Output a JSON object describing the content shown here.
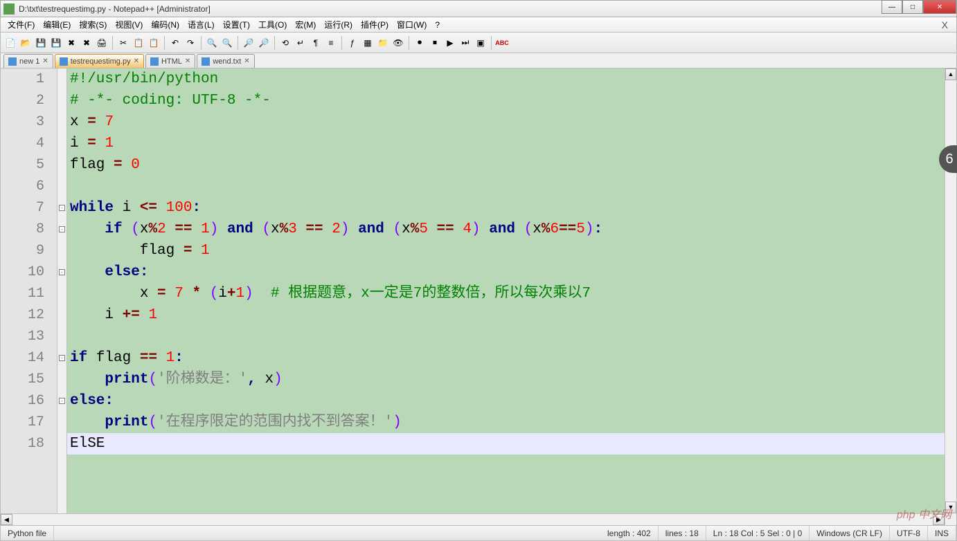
{
  "window": {
    "title": "D:\\txt\\testrequestimg.py - Notepad++ [Administrator]"
  },
  "menu": [
    "文件(F)",
    "编辑(E)",
    "搜索(S)",
    "视图(V)",
    "编码(N)",
    "语言(L)",
    "设置(T)",
    "工具(O)",
    "宏(M)",
    "运行(R)",
    "插件(P)",
    "窗口(W)",
    "?"
  ],
  "tabs": [
    {
      "label": "new 1",
      "active": false
    },
    {
      "label": "testrequestimg.py",
      "active": true
    },
    {
      "label": "HTML",
      "active": false
    },
    {
      "label": "wend.txt",
      "active": false
    }
  ],
  "code": {
    "lines": [
      {
        "n": 1,
        "tokens": [
          {
            "t": "#!/usr/bin/python",
            "c": "c-comment"
          }
        ]
      },
      {
        "n": 2,
        "tokens": [
          {
            "t": "# -*- coding: UTF-8 -*-",
            "c": "c-comment"
          }
        ]
      },
      {
        "n": 3,
        "tokens": [
          {
            "t": "x ",
            "c": "c-id"
          },
          {
            "t": "=",
            "c": "c-opred"
          },
          {
            "t": " ",
            "c": ""
          },
          {
            "t": "7",
            "c": "c-num"
          }
        ]
      },
      {
        "n": 4,
        "tokens": [
          {
            "t": "i ",
            "c": "c-id"
          },
          {
            "t": "=",
            "c": "c-opred"
          },
          {
            "t": " ",
            "c": ""
          },
          {
            "t": "1",
            "c": "c-num"
          }
        ]
      },
      {
        "n": 5,
        "tokens": [
          {
            "t": "flag ",
            "c": "c-id"
          },
          {
            "t": "=",
            "c": "c-opred"
          },
          {
            "t": " ",
            "c": ""
          },
          {
            "t": "0",
            "c": "c-num"
          }
        ]
      },
      {
        "n": 6,
        "tokens": []
      },
      {
        "n": 7,
        "tokens": [
          {
            "t": "while",
            "c": "c-keyword"
          },
          {
            "t": " i ",
            "c": "c-id"
          },
          {
            "t": "<=",
            "c": "c-opred"
          },
          {
            "t": " ",
            "c": ""
          },
          {
            "t": "100",
            "c": "c-num"
          },
          {
            "t": ":",
            "c": "c-op"
          }
        ]
      },
      {
        "n": 8,
        "tokens": [
          {
            "t": "    ",
            "c": ""
          },
          {
            "t": "if",
            "c": "c-keyword"
          },
          {
            "t": " ",
            "c": ""
          },
          {
            "t": "(",
            "c": "c-paren"
          },
          {
            "t": "x",
            "c": "c-id"
          },
          {
            "t": "%",
            "c": "c-opred"
          },
          {
            "t": "2",
            "c": "c-num"
          },
          {
            "t": " ",
            "c": ""
          },
          {
            "t": "==",
            "c": "c-opred"
          },
          {
            "t": " ",
            "c": ""
          },
          {
            "t": "1",
            "c": "c-num"
          },
          {
            "t": ")",
            "c": "c-paren"
          },
          {
            "t": " ",
            "c": ""
          },
          {
            "t": "and",
            "c": "c-keyword"
          },
          {
            "t": " ",
            "c": ""
          },
          {
            "t": "(",
            "c": "c-paren"
          },
          {
            "t": "x",
            "c": "c-id"
          },
          {
            "t": "%",
            "c": "c-opred"
          },
          {
            "t": "3",
            "c": "c-num"
          },
          {
            "t": " ",
            "c": ""
          },
          {
            "t": "==",
            "c": "c-opred"
          },
          {
            "t": " ",
            "c": ""
          },
          {
            "t": "2",
            "c": "c-num"
          },
          {
            "t": ")",
            "c": "c-paren"
          },
          {
            "t": " ",
            "c": ""
          },
          {
            "t": "and",
            "c": "c-keyword"
          },
          {
            "t": " ",
            "c": ""
          },
          {
            "t": "(",
            "c": "c-paren"
          },
          {
            "t": "x",
            "c": "c-id"
          },
          {
            "t": "%",
            "c": "c-opred"
          },
          {
            "t": "5",
            "c": "c-num"
          },
          {
            "t": " ",
            "c": ""
          },
          {
            "t": "==",
            "c": "c-opred"
          },
          {
            "t": " ",
            "c": ""
          },
          {
            "t": "4",
            "c": "c-num"
          },
          {
            "t": ")",
            "c": "c-paren"
          },
          {
            "t": " ",
            "c": ""
          },
          {
            "t": "and",
            "c": "c-keyword"
          },
          {
            "t": " ",
            "c": ""
          },
          {
            "t": "(",
            "c": "c-paren"
          },
          {
            "t": "x",
            "c": "c-id"
          },
          {
            "t": "%",
            "c": "c-opred"
          },
          {
            "t": "6",
            "c": "c-num"
          },
          {
            "t": "==",
            "c": "c-opred"
          },
          {
            "t": "5",
            "c": "c-num"
          },
          {
            "t": ")",
            "c": "c-paren"
          },
          {
            "t": ":",
            "c": "c-op"
          }
        ]
      },
      {
        "n": 9,
        "tokens": [
          {
            "t": "        flag ",
            "c": "c-id"
          },
          {
            "t": "=",
            "c": "c-opred"
          },
          {
            "t": " ",
            "c": ""
          },
          {
            "t": "1",
            "c": "c-num"
          }
        ]
      },
      {
        "n": 10,
        "tokens": [
          {
            "t": "    ",
            "c": ""
          },
          {
            "t": "else",
            "c": "c-keyword"
          },
          {
            "t": ":",
            "c": "c-op"
          }
        ]
      },
      {
        "n": 11,
        "tokens": [
          {
            "t": "        x ",
            "c": "c-id"
          },
          {
            "t": "=",
            "c": "c-opred"
          },
          {
            "t": " ",
            "c": ""
          },
          {
            "t": "7",
            "c": "c-num"
          },
          {
            "t": " ",
            "c": ""
          },
          {
            "t": "*",
            "c": "c-opred"
          },
          {
            "t": " ",
            "c": ""
          },
          {
            "t": "(",
            "c": "c-paren"
          },
          {
            "t": "i",
            "c": "c-id"
          },
          {
            "t": "+",
            "c": "c-opred"
          },
          {
            "t": "1",
            "c": "c-num"
          },
          {
            "t": ")",
            "c": "c-paren"
          },
          {
            "t": "  ",
            "c": ""
          },
          {
            "t": "# 根据题意，x一定是7的整数倍，所以每次乘以7",
            "c": "c-comment"
          }
        ]
      },
      {
        "n": 12,
        "tokens": [
          {
            "t": "    i ",
            "c": "c-id"
          },
          {
            "t": "+=",
            "c": "c-opred"
          },
          {
            "t": " ",
            "c": ""
          },
          {
            "t": "1",
            "c": "c-num"
          }
        ]
      },
      {
        "n": 13,
        "tokens": []
      },
      {
        "n": 14,
        "tokens": [
          {
            "t": "if",
            "c": "c-keyword"
          },
          {
            "t": " flag ",
            "c": "c-id"
          },
          {
            "t": "==",
            "c": "c-opred"
          },
          {
            "t": " ",
            "c": ""
          },
          {
            "t": "1",
            "c": "c-num"
          },
          {
            "t": ":",
            "c": "c-op"
          }
        ]
      },
      {
        "n": 15,
        "tokens": [
          {
            "t": "    ",
            "c": ""
          },
          {
            "t": "print",
            "c": "c-keyword"
          },
          {
            "t": "(",
            "c": "c-paren"
          },
          {
            "t": "'阶梯数是：'",
            "c": "c-str"
          },
          {
            "t": ",",
            "c": "c-op"
          },
          {
            "t": " x",
            "c": "c-id"
          },
          {
            "t": ")",
            "c": "c-paren"
          }
        ]
      },
      {
        "n": 16,
        "tokens": [
          {
            "t": "else",
            "c": "c-keyword"
          },
          {
            "t": ":",
            "c": "c-op"
          }
        ]
      },
      {
        "n": 17,
        "tokens": [
          {
            "t": "    ",
            "c": ""
          },
          {
            "t": "print",
            "c": "c-keyword"
          },
          {
            "t": "(",
            "c": "c-paren"
          },
          {
            "t": "'在程序限定的范围内找不到答案！'",
            "c": "c-str"
          },
          {
            "t": ")",
            "c": "c-paren"
          }
        ]
      },
      {
        "n": 18,
        "tokens": [
          {
            "t": "ElSE",
            "c": "c-id"
          }
        ],
        "current": true
      }
    ]
  },
  "status": {
    "filetype": "Python file",
    "length": "length : 402",
    "lines": "lines : 18",
    "pos": "Ln : 18    Col : 5    Sel : 0 | 0",
    "eol": "Windows (CR LF)",
    "encoding": "UTF-8",
    "mode": "INS"
  },
  "watermark": "php 中文网",
  "side_badge": "6"
}
